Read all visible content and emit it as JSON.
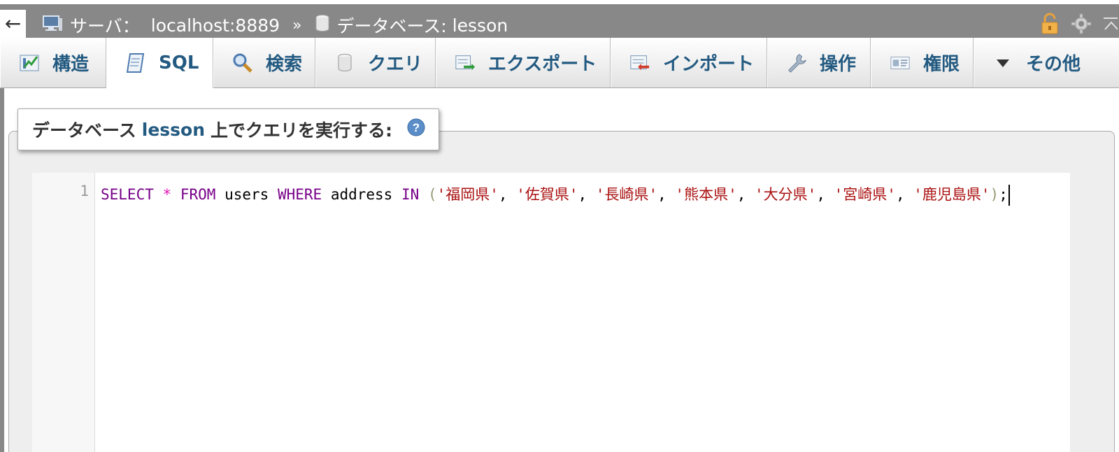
{
  "topbar": {
    "back_label": "←",
    "server_label": "サーバ：",
    "server_value": "localhost:8889",
    "separator": "»",
    "db_label": "データベース:",
    "db_value": "lesson"
  },
  "tabs": [
    {
      "label": "構造",
      "icon": "structure-icon"
    },
    {
      "label": "SQL",
      "icon": "sql-icon"
    },
    {
      "label": "検索",
      "icon": "search-icon"
    },
    {
      "label": "クエリ",
      "icon": "query-icon"
    },
    {
      "label": "エクスポート",
      "icon": "export-icon"
    },
    {
      "label": "インポート",
      "icon": "import-icon"
    },
    {
      "label": "操作",
      "icon": "wrench-icon"
    },
    {
      "label": "権限",
      "icon": "privileges-icon"
    },
    {
      "label": "その他",
      "icon": "triangle-down-icon"
    }
  ],
  "panel": {
    "legend_prefix": "データベース",
    "legend_db": "lesson",
    "legend_suffix": "上でクエリを実行する:"
  },
  "editor": {
    "line_number": "1",
    "tokens": {
      "select": "SELECT",
      "star": "*",
      "from": "FROM",
      "table": "users",
      "where": "WHERE",
      "column": "address",
      "in": "IN",
      "open": "(",
      "close": ")",
      "semicolon": ";",
      "comma": ",",
      "v1": "'福岡県'",
      "v2": "'佐賀県'",
      "v3": "'長崎県'",
      "v4": "'熊本県'",
      "v5": "'大分県'",
      "v6": "'宮崎県'",
      "v7": "'鹿児島県'"
    }
  },
  "colors": {
    "tab_text": "#235a81",
    "keyword": "#770088",
    "string": "#aa1111",
    "topbar": "#888888"
  }
}
